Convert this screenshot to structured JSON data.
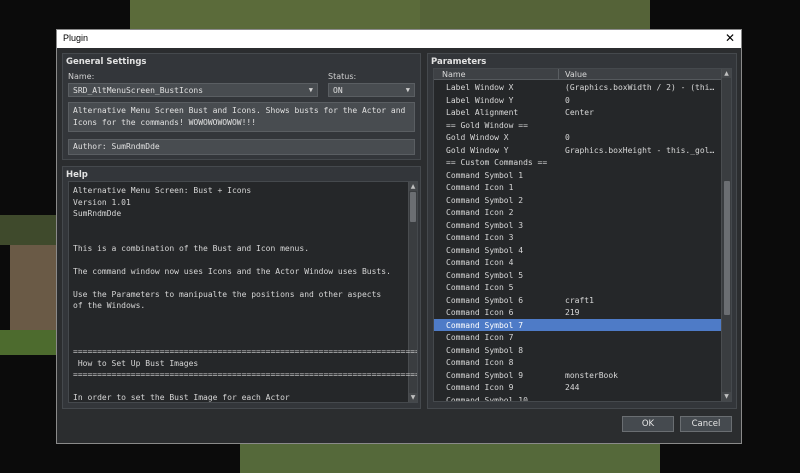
{
  "window": {
    "title": "Plugin",
    "close_glyph": "✕"
  },
  "general": {
    "heading": "General Settings",
    "name_label": "Name:",
    "name_value": "SRD_AltMenuScreen_BustIcons",
    "status_label": "Status:",
    "status_value": "ON",
    "description": "Alternative Menu Screen Bust and Icons. Shows busts for the Actor and Icons for the commands! WOWOWOWOWOW!!!",
    "author": "Author: SumRndmDde"
  },
  "help": {
    "heading": "Help",
    "lines": [
      "Alternative Menu Screen: Bust + Icons",
      "Version 1.01",
      "SumRndmDde",
      "",
      "",
      "This is a combination of the Bust and Icon menus.",
      "",
      "The command window now uses Icons and the Actor Window uses Busts.",
      "",
      "Use the Parameters to manipualte the positions and other aspects",
      "of the Windows.",
      "",
      "",
      "",
      "=========================================================================",
      " How to Set Up Bust Images",
      "=========================================================================",
      "",
      "In order to set the Bust Image for each Actor"
    ]
  },
  "parameters": {
    "heading": "Parameters",
    "col_name": "Name",
    "col_value": "Value",
    "selected_index": 19,
    "rows": [
      {
        "name": "Label Window X",
        "value": "(Graphics.boxWidth / 2) - (this._c..."
      },
      {
        "name": "Label Window Y",
        "value": "0"
      },
      {
        "name": "Label Alignment",
        "value": "Center"
      },
      {
        "name": "== Gold Window ==",
        "value": ""
      },
      {
        "name": "Gold Window X",
        "value": "0"
      },
      {
        "name": "Gold Window Y",
        "value": "Graphics.boxHeight - this._goldWin..."
      },
      {
        "name": "== Custom Commands ==",
        "value": ""
      },
      {
        "name": "Command Symbol 1",
        "value": ""
      },
      {
        "name": "Command Icon 1",
        "value": ""
      },
      {
        "name": "Command Symbol 2",
        "value": ""
      },
      {
        "name": "Command Icon 2",
        "value": ""
      },
      {
        "name": "Command Symbol 3",
        "value": ""
      },
      {
        "name": "Command Icon 3",
        "value": ""
      },
      {
        "name": "Command Symbol 4",
        "value": ""
      },
      {
        "name": "Command Icon 4",
        "value": ""
      },
      {
        "name": "Command Symbol 5",
        "value": ""
      },
      {
        "name": "Command Icon 5",
        "value": ""
      },
      {
        "name": "Command Symbol 6",
        "value": "craft1"
      },
      {
        "name": "Command Icon 6",
        "value": "219"
      },
      {
        "name": "Command Symbol 7",
        "value": ""
      },
      {
        "name": "Command Icon 7",
        "value": ""
      },
      {
        "name": "Command Symbol 8",
        "value": ""
      },
      {
        "name": "Command Icon 8",
        "value": ""
      },
      {
        "name": "Command Symbol 9",
        "value": "monsterBook"
      },
      {
        "name": "Command Icon 9",
        "value": "244"
      },
      {
        "name": "Command Symbol 10",
        "value": ""
      }
    ]
  },
  "buttons": {
    "ok": "OK",
    "cancel": "Cancel"
  },
  "colors": {
    "selection": "#4e7bc7",
    "panel": "#33363a",
    "window": "#2b2d2f"
  }
}
